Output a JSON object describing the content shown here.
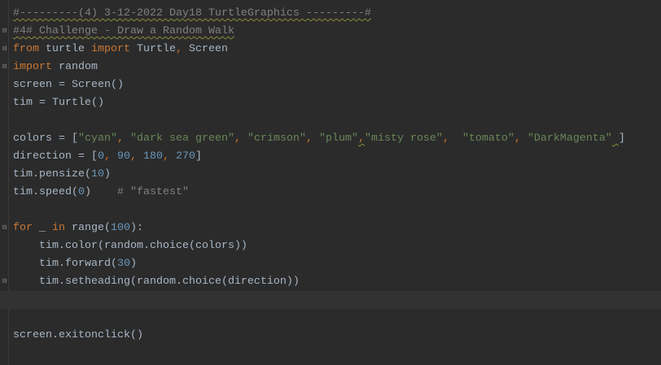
{
  "editor": {
    "current_line": 16,
    "colors": {
      "background": "#2b2b2b",
      "current_line": "#323232",
      "keyword": "#cc7832",
      "string": "#6a8759",
      "number": "#6897bb",
      "comment": "#808080",
      "text": "#a9b7c6"
    },
    "lines": [
      {
        "fold": false,
        "tokens": [
          [
            "cm w",
            "#---------(4) 3-12-2022 Day18 TurtleGraphics ---------#"
          ]
        ]
      },
      {
        "fold": true,
        "tokens": [
          [
            "cm w",
            "#4# Challenge - Draw a Random Walk"
          ]
        ]
      },
      {
        "fold": true,
        "tokens": [
          [
            "kw",
            "from"
          ],
          [
            "id",
            " turtle "
          ],
          [
            "kw",
            "import"
          ],
          [
            "id",
            " Turtle"
          ],
          [
            "punct",
            ","
          ],
          [
            "id",
            " Screen"
          ]
        ]
      },
      {
        "fold": true,
        "tokens": [
          [
            "kw",
            "import"
          ],
          [
            "id",
            " random"
          ]
        ]
      },
      {
        "fold": false,
        "tokens": [
          [
            "id",
            "screen = Screen()"
          ]
        ]
      },
      {
        "fold": false,
        "tokens": [
          [
            "id",
            "tim = Turtle()"
          ]
        ]
      },
      {
        "fold": false,
        "tokens": []
      },
      {
        "fold": false,
        "tokens": [
          [
            "id",
            "colors = ["
          ],
          [
            "str",
            "\"cyan\""
          ],
          [
            "punct",
            ","
          ],
          [
            "id",
            " "
          ],
          [
            "str",
            "\"dark sea green\""
          ],
          [
            "punct",
            ","
          ],
          [
            "id",
            " "
          ],
          [
            "str",
            "\"crimson\""
          ],
          [
            "punct",
            ","
          ],
          [
            "id",
            " "
          ],
          [
            "str",
            "\"plum\""
          ],
          [
            "punct w",
            ","
          ],
          [
            "str",
            "\"misty rose\""
          ],
          [
            "punct",
            ","
          ],
          [
            "id",
            "  "
          ],
          [
            "str",
            "\"tomato\""
          ],
          [
            "punct",
            ","
          ],
          [
            "id",
            " "
          ],
          [
            "str",
            "\"DarkMagenta\""
          ],
          [
            "id w",
            " "
          ],
          [
            "id",
            "]"
          ]
        ]
      },
      {
        "fold": false,
        "tokens": [
          [
            "id",
            "direction = ["
          ],
          [
            "num",
            "0"
          ],
          [
            "punct",
            ","
          ],
          [
            "id",
            " "
          ],
          [
            "num",
            "90"
          ],
          [
            "punct",
            ","
          ],
          [
            "id",
            " "
          ],
          [
            "num",
            "180"
          ],
          [
            "punct",
            ","
          ],
          [
            "id",
            " "
          ],
          [
            "num",
            "270"
          ],
          [
            "id",
            "]"
          ]
        ]
      },
      {
        "fold": false,
        "tokens": [
          [
            "id",
            "tim.pensize("
          ],
          [
            "num",
            "10"
          ],
          [
            "id",
            ")"
          ]
        ]
      },
      {
        "fold": false,
        "tokens": [
          [
            "id",
            "tim.speed("
          ],
          [
            "num",
            "0"
          ],
          [
            "id",
            ")    "
          ],
          [
            "cm",
            "# \"fastest\""
          ]
        ]
      },
      {
        "fold": false,
        "tokens": []
      },
      {
        "fold": true,
        "tokens": [
          [
            "kw",
            "for"
          ],
          [
            "id",
            " _ "
          ],
          [
            "kw",
            "in"
          ],
          [
            "id",
            " range("
          ],
          [
            "num",
            "100"
          ],
          [
            "id",
            "):"
          ]
        ]
      },
      {
        "fold": false,
        "tokens": [
          [
            "id",
            "    tim.color(random.choice(colors))"
          ]
        ]
      },
      {
        "fold": false,
        "tokens": [
          [
            "id",
            "    tim.forward("
          ],
          [
            "num",
            "30"
          ],
          [
            "id",
            ")"
          ]
        ]
      },
      {
        "fold": true,
        "tokens": [
          [
            "id",
            "    tim.setheading(random.choice(direction))"
          ]
        ]
      },
      {
        "fold": false,
        "tokens": []
      },
      {
        "fold": false,
        "tokens": []
      },
      {
        "fold": false,
        "tokens": [
          [
            "id",
            "screen.exitonclick()"
          ]
        ]
      }
    ]
  }
}
